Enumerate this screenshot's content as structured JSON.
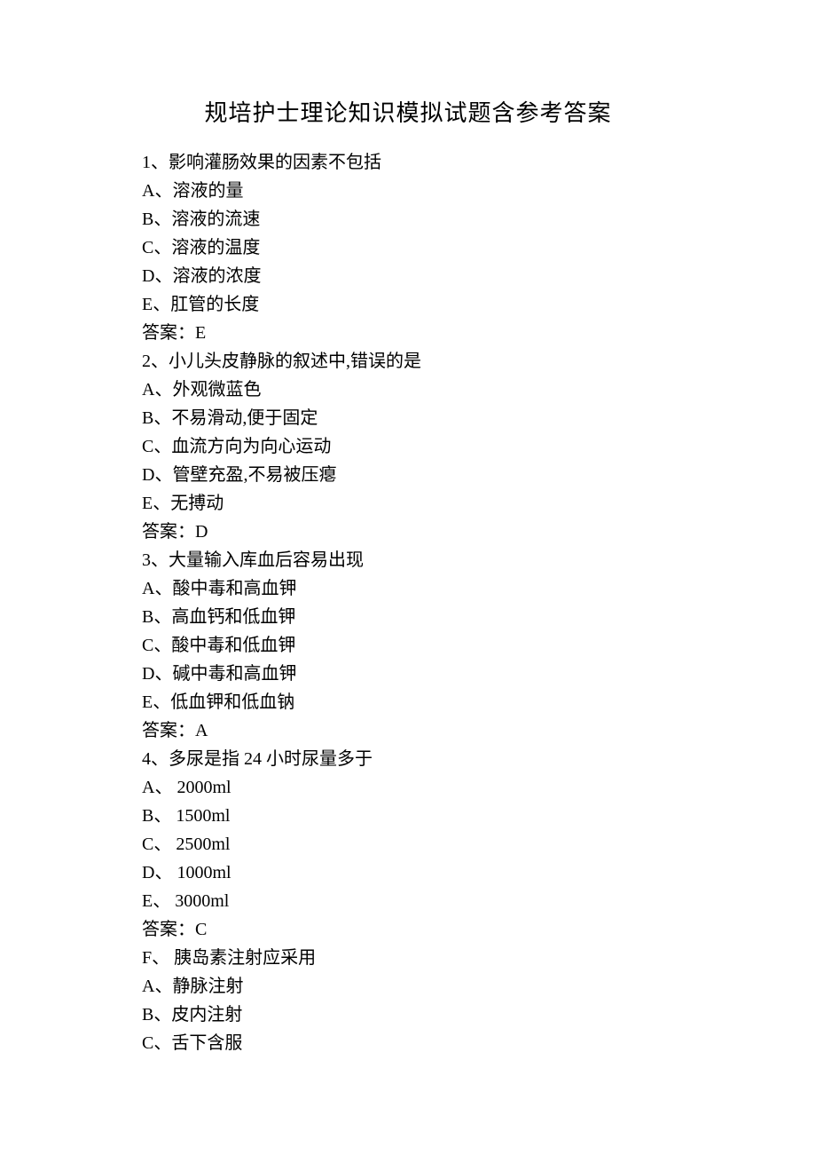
{
  "title": "规培护士理论知识模拟试题含参考答案",
  "questions": [
    {
      "num": "1",
      "stem": "影响灌肠效果的因素不包括",
      "options": [
        {
          "letter": "A",
          "text": "溶液的量"
        },
        {
          "letter": "B",
          "text": "溶液的流速"
        },
        {
          "letter": "C",
          "text": "溶液的温度"
        },
        {
          "letter": "D",
          "text": "溶液的浓度"
        },
        {
          "letter": "E",
          "text": "肛管的长度"
        }
      ],
      "answer": "E"
    },
    {
      "num": "2",
      "stem": "小儿头皮静脉的叙述中,错误的是",
      "options": [
        {
          "letter": "A",
          "text": "外观微蓝色"
        },
        {
          "letter": "B",
          "text": "不易滑动,便于固定"
        },
        {
          "letter": "C",
          "text": "血流方向为向心运动"
        },
        {
          "letter": "D",
          "text": "管壁充盈,不易被压瘪"
        },
        {
          "letter": "E",
          "text": "无搏动"
        }
      ],
      "answer": "D"
    },
    {
      "num": "3",
      "stem": "大量输入库血后容易出现",
      "options": [
        {
          "letter": "A",
          "text": "酸中毒和高血钾"
        },
        {
          "letter": "B",
          "text": "高血钙和低血钾"
        },
        {
          "letter": "C",
          "text": "酸中毒和低血钾"
        },
        {
          "letter": "D",
          "text": "碱中毒和高血钾"
        },
        {
          "letter": "E",
          "text": "低血钾和低血钠"
        }
      ],
      "answer": "A"
    },
    {
      "num": "4",
      "stem": "多尿是指 24 小时尿量多于",
      "options": [
        {
          "letter": "A",
          "text": " 2000ml"
        },
        {
          "letter": "B",
          "text": " 1500ml"
        },
        {
          "letter": "C",
          "text": " 2500ml"
        },
        {
          "letter": "D",
          "text": " 1000ml"
        },
        {
          "letter": "E",
          "text": " 3000ml"
        }
      ],
      "answer": "C"
    },
    {
      "num": "F",
      "stem": " 胰岛素注射应采用",
      "options": [
        {
          "letter": "A",
          "text": "静脉注射"
        },
        {
          "letter": "B",
          "text": "皮内注射"
        },
        {
          "letter": "C",
          "text": "舌下含服"
        }
      ],
      "answer": null
    }
  ],
  "labels": {
    "answerPrefix": "答案：",
    "stemSep": "、",
    "optSep": "、"
  }
}
